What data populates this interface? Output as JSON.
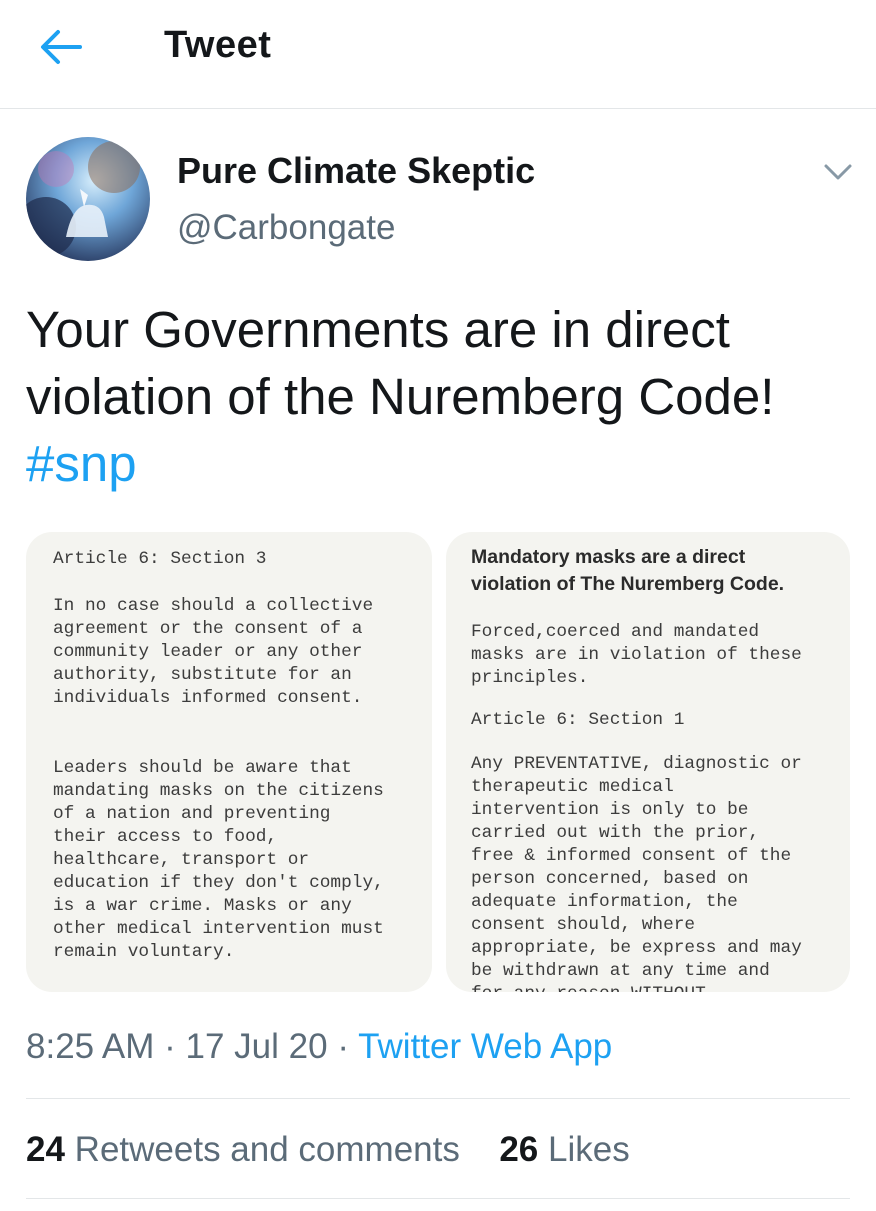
{
  "header": {
    "title": "Tweet"
  },
  "author": {
    "name": "Pure Climate Skeptic",
    "handle": "@Carbongate"
  },
  "tweet": {
    "text_line1": "Your Governments are in direct",
    "text_line2": "violation of the Nuremberg Code!",
    "hashtag": "#snp"
  },
  "images": {
    "left": {
      "heading": "Article 6: Section 3",
      "para1": "In no case should a collective\nagreement or the consent of a\ncommunity leader or any other\nauthority, substitute for an\nindividuals informed consent.",
      "para2": "Leaders should be aware that\nmandating masks on the citizens\nof a nation and preventing\ntheir access to food,\nhealthcare, transport or\neducation if they don't comply,\nis a war crime. Masks or any\nother medical intervention must\nremain voluntary."
    },
    "right": {
      "headline": "Mandatory masks are a direct\nviolation of The Nuremberg Code.",
      "para1": "Forced,coerced and mandated\nmasks are in violation of these\nprinciples.",
      "heading": "Article 6: Section 1",
      "para2": "Any PREVENTATIVE, diagnostic or\ntherapeutic medical\nintervention is only to be\ncarried out with the prior,\nfree & informed consent of the\nperson concerned, based on\nadequate information, the\nconsent should, where\nappropriate, be express and may\nbe withdrawn at any time and\nfor any reason WITHOUT"
    }
  },
  "meta": {
    "time": "8:25 AM",
    "sep1": " · ",
    "date": "17 Jul 20",
    "sep2": " · ",
    "app": "Twitter Web App"
  },
  "stats": {
    "retweets_count": "24",
    "retweets_label": "Retweets and comments",
    "likes_count": "26",
    "likes_label": "Likes"
  },
  "colors": {
    "accent": "#1da1f2",
    "secondary_text": "#5b6b78",
    "primary_text": "#14171a"
  },
  "icons": {
    "back": "arrow-left-icon",
    "menu": "chevron-down-icon"
  }
}
